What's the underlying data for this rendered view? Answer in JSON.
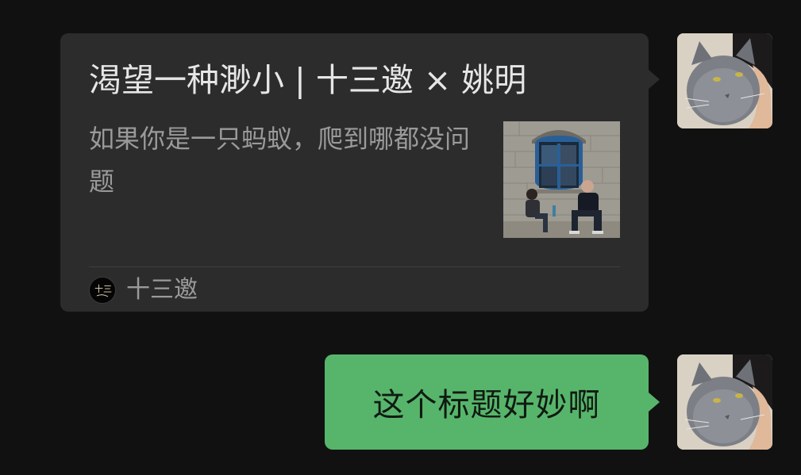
{
  "colors": {
    "background": "#111111",
    "card_bg": "#2c2c2c",
    "title_text": "#e6e6e6",
    "secondary_text": "#9a9a9a",
    "sent_bubble": "#57b56b"
  },
  "messages": [
    {
      "type": "link_card",
      "sender": "self",
      "title": "渴望一种渺小 | 十三邀 × 姚明",
      "description": "如果你是一只蚂蚁，爬到哪都没问题",
      "thumbnail_icon": "photo-two-men-sitting-by-blue-window",
      "source": {
        "logo_text": "十三",
        "logo_icon": "shisanyao-logo",
        "name": "十三邀"
      },
      "avatar_icon": "gray-cat-avatar"
    },
    {
      "type": "text",
      "sender": "self",
      "text": "这个标题好妙啊",
      "avatar_icon": "gray-cat-avatar"
    }
  ]
}
